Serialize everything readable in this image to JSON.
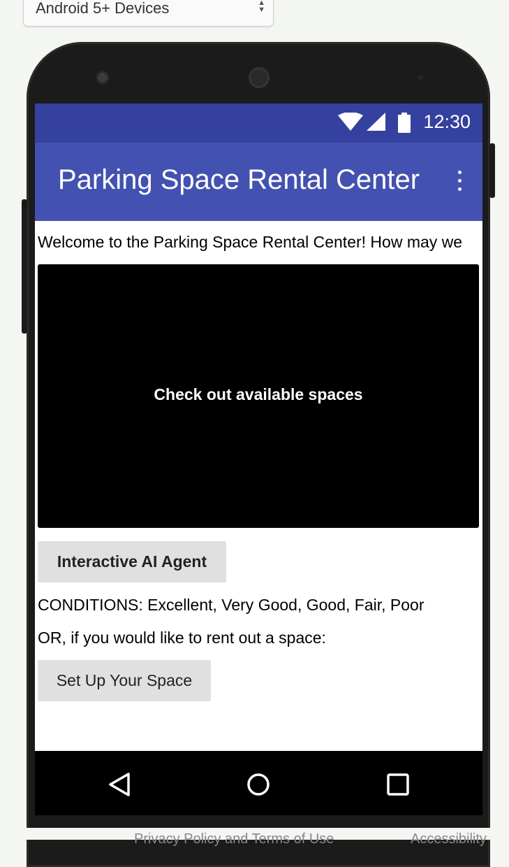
{
  "device_selector": {
    "selected": "Android 5+ Devices"
  },
  "status_bar": {
    "time": "12:30",
    "wifi_icon": "wifi-icon",
    "signal_icon": "signal-icon",
    "battery_icon": "battery-icon"
  },
  "app_bar": {
    "title": "Parking Space Rental Center",
    "overflow_icon": "more-vert-icon"
  },
  "content": {
    "welcome": "Welcome to the Parking Space Rental Center! How may we",
    "hero_button": "Check out available spaces",
    "ai_button": "Interactive AI Agent",
    "conditions": "CONDITIONS: Excellent, Very Good, Good, Fair, Poor",
    "rent_out_prompt": "OR, if you would like to rent out a space:",
    "setup_button": "Set Up Your Space"
  },
  "nav_bar": {
    "back_icon": "back-triangle-icon",
    "home_icon": "home-circle-icon",
    "recents_icon": "recents-square-icon"
  },
  "footer": {
    "privacy": "Privacy Policy and Terms of Use",
    "accessibility": "Accessibility"
  },
  "colors": {
    "status_bar": "#34419e",
    "app_bar": "#4351b0",
    "button": "#e0e0e0"
  }
}
